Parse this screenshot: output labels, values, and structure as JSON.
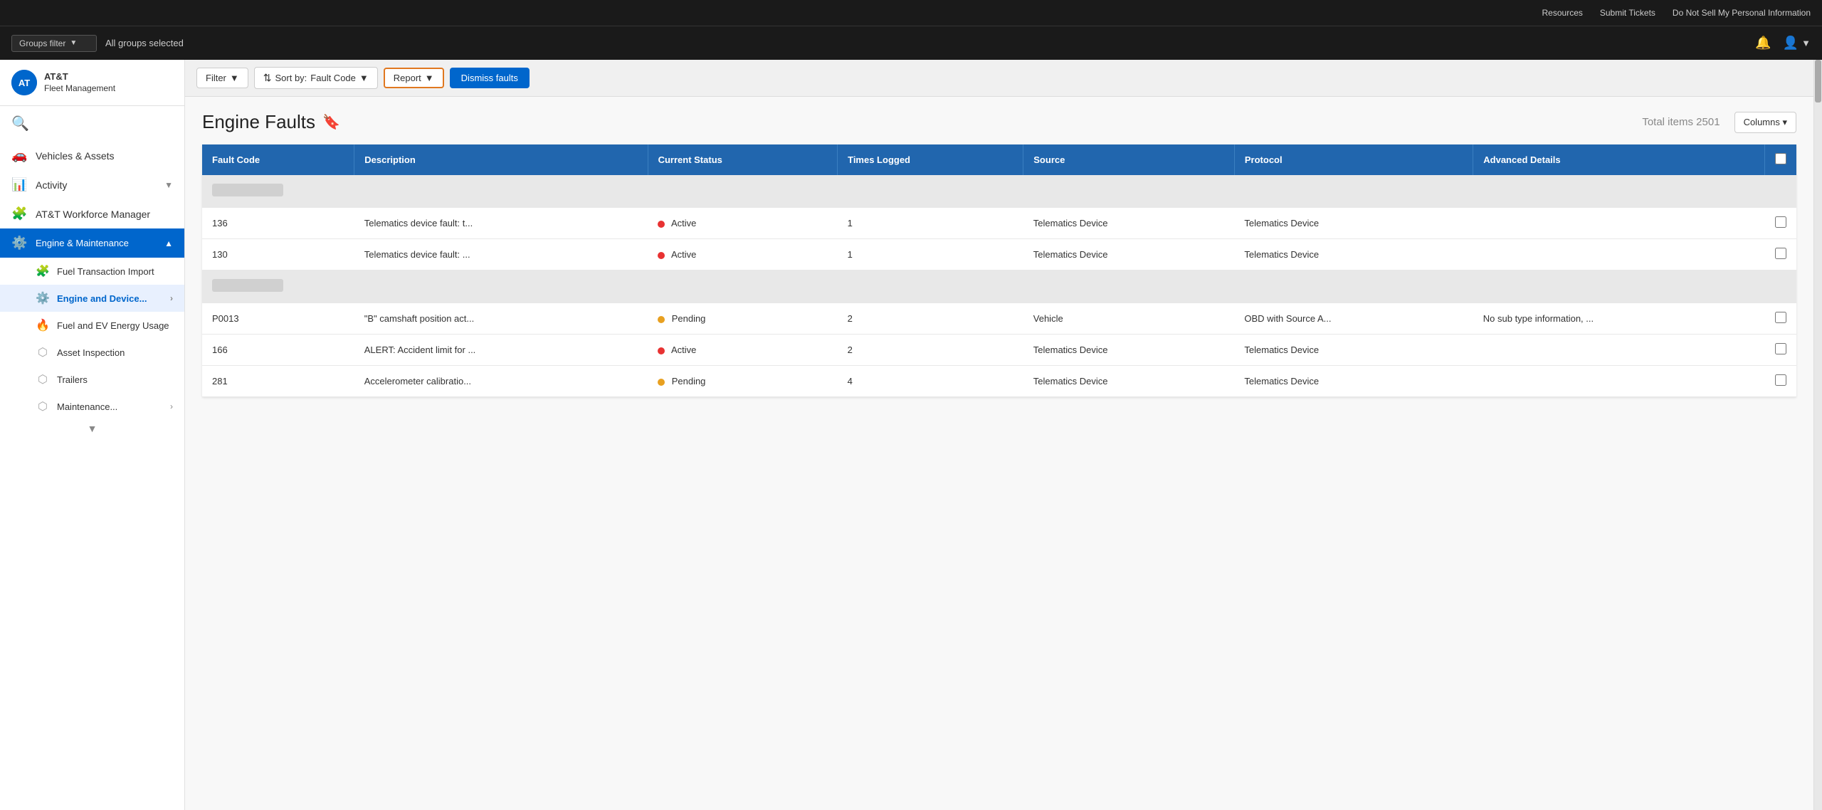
{
  "topbar": {
    "links": [
      "Resources",
      "Submit Tickets",
      "Do Not Sell My Personal Information"
    ]
  },
  "headerbar": {
    "groups_filter_label": "Groups filter",
    "chevron": "▼",
    "all_groups_text": "All groups selected"
  },
  "sidebar": {
    "logo_initials": "AT",
    "brand_line1": "AT&T",
    "brand_line2": "Fleet Management",
    "search_icon": "🔍",
    "nav_items": [
      {
        "id": "vehicles",
        "label": "Vehicles & Assets",
        "icon": "🚗",
        "has_chevron": false
      },
      {
        "id": "activity",
        "label": "Activity",
        "icon": "📊",
        "has_chevron": true
      },
      {
        "id": "workforce",
        "label": "AT&T Workforce Manager",
        "icon": "🧩",
        "has_chevron": false
      },
      {
        "id": "engine",
        "label": "Engine & Maintenance",
        "icon": "⚙️",
        "has_chevron": true,
        "active": true
      }
    ],
    "sub_items": [
      {
        "id": "fuel-import",
        "label": "Fuel Transaction Import",
        "icon": "🧩"
      },
      {
        "id": "engine-device",
        "label": "Engine and Device...",
        "icon": "⚙️",
        "has_chevron": true,
        "active_sub": true
      },
      {
        "id": "fuel-ev",
        "label": "Fuel and EV Energy Usage",
        "icon": "🔥"
      },
      {
        "id": "asset-inspection",
        "label": "Asset Inspection",
        "icon": "⬡"
      },
      {
        "id": "trailers",
        "label": "Trailers",
        "icon": "⬡"
      },
      {
        "id": "maintenance",
        "label": "Maintenance...",
        "icon": "⬡",
        "has_chevron": true
      }
    ]
  },
  "toolbar": {
    "filter_label": "Filter",
    "sort_label": "Sort by:",
    "sort_value": "Fault Code",
    "report_label": "Report",
    "dismiss_label": "Dismiss faults"
  },
  "page": {
    "title": "Engine Faults",
    "bookmark_icon": "🔖",
    "total_items_label": "Total items 2501",
    "columns_label": "Columns ▾"
  },
  "table": {
    "columns": [
      {
        "id": "fault-code",
        "label": "Fault Code"
      },
      {
        "id": "description",
        "label": "Description"
      },
      {
        "id": "current-status",
        "label": "Current Status"
      },
      {
        "id": "times-logged",
        "label": "Times Logged"
      },
      {
        "id": "source",
        "label": "Source"
      },
      {
        "id": "protocol",
        "label": "Protocol"
      },
      {
        "id": "advanced-details",
        "label": "Advanced Details"
      },
      {
        "id": "select-all",
        "label": "checkbox"
      }
    ],
    "rows": [
      {
        "type": "group",
        "colspan": 8
      },
      {
        "type": "data",
        "fault_code": "136",
        "description": "Telematics device fault: t...",
        "status": "Active",
        "status_type": "active",
        "times_logged": "1",
        "source": "Telematics Device",
        "protocol": "Telematics Device",
        "advanced_details": ""
      },
      {
        "type": "data",
        "fault_code": "130",
        "description": "Telematics device fault: ...",
        "status": "Active",
        "status_type": "active",
        "times_logged": "1",
        "source": "Telematics Device",
        "protocol": "Telematics Device",
        "advanced_details": ""
      },
      {
        "type": "group",
        "colspan": 8
      },
      {
        "type": "data",
        "fault_code": "P0013",
        "description": "\"B\" camshaft position act...",
        "status": "Pending",
        "status_type": "pending",
        "times_logged": "2",
        "source": "Vehicle",
        "protocol": "OBD with Source A...",
        "advanced_details": "No sub type information, ..."
      },
      {
        "type": "data",
        "fault_code": "166",
        "description": "ALERT: Accident limit for ...",
        "status": "Active",
        "status_type": "active",
        "times_logged": "2",
        "source": "Telematics Device",
        "protocol": "Telematics Device",
        "advanced_details": ""
      },
      {
        "type": "data",
        "fault_code": "281",
        "description": "Accelerometer calibratio...",
        "status": "Pending",
        "status_type": "pending",
        "times_logged": "4",
        "source": "Telematics Device",
        "protocol": "Telematics Device",
        "advanced_details": ""
      }
    ]
  }
}
